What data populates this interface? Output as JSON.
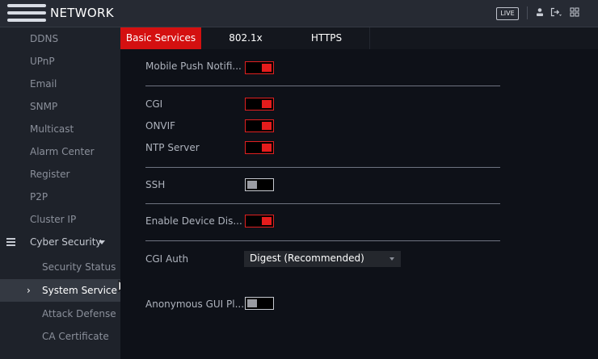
{
  "header": {
    "title": "NETWORK",
    "live_label": "LIVE",
    "icons": [
      "user-icon",
      "logout-icon",
      "grid-icon"
    ]
  },
  "sidebar": {
    "items": [
      {
        "label": "DDNS"
      },
      {
        "label": "UPnP"
      },
      {
        "label": "Email"
      },
      {
        "label": "SNMP"
      },
      {
        "label": "Multicast"
      },
      {
        "label": "Alarm Center"
      },
      {
        "label": "Register"
      },
      {
        "label": "P2P"
      },
      {
        "label": "Cluster IP"
      },
      {
        "label": "Cyber Security",
        "state": "expanded"
      },
      {
        "label": "Security Status",
        "level": "sub"
      },
      {
        "label": "System Service",
        "level": "sub",
        "state": "active"
      },
      {
        "label": "Attack Defense",
        "level": "sub"
      },
      {
        "label": "CA Certificate",
        "level": "sub"
      }
    ]
  },
  "tabs": [
    {
      "label": "Basic Services",
      "active": true
    },
    {
      "label": "802.1x",
      "active": false
    },
    {
      "label": "HTTPS",
      "active": false
    }
  ],
  "form": {
    "mobile_push": {
      "label": "Mobile Push Notifi...",
      "enabled": true
    },
    "cgi": {
      "label": "CGI",
      "enabled": true
    },
    "onvif": {
      "label": "ONVIF",
      "enabled": true
    },
    "ntp_server": {
      "label": "NTP Server",
      "enabled": true
    },
    "ssh": {
      "label": "SSH",
      "enabled": false
    },
    "device_discovery": {
      "label": "Enable Device Dis...",
      "enabled": true
    },
    "cgi_auth": {
      "label": "CGI Auth",
      "value": "Digest (Recommended)"
    },
    "anonymous_gui": {
      "label": "Anonymous GUI Pl...",
      "enabled": false
    }
  },
  "colors": {
    "accent": "#d41010",
    "toggle_on": "#e51c1c",
    "sidebar_bg": "#1e222a",
    "main_bg": "#0e1118"
  }
}
